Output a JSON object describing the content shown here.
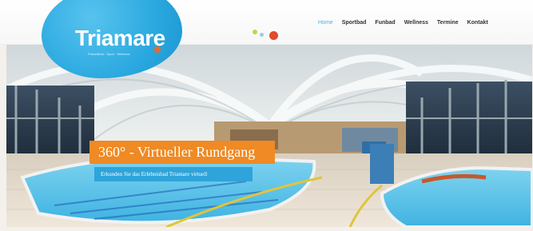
{
  "logo": {
    "name": "Triamare",
    "subline": "Freizeitbad · Sport · Wellness"
  },
  "nav": {
    "items": [
      {
        "label": "Home",
        "active": true
      },
      {
        "label": "Sportbad",
        "active": false
      },
      {
        "label": "Funbad",
        "active": false
      },
      {
        "label": "Wellness",
        "active": false
      },
      {
        "label": "Termine",
        "active": false
      },
      {
        "label": "Kontakt",
        "active": false
      }
    ]
  },
  "hero": {
    "title": "360° - Virtueller Rundgang",
    "subtitle": "Erkunden Sie das Erlebnisbad Triamare virtuell"
  },
  "colors": {
    "logo_blue": "#2aa8df",
    "nav_active": "#46b3e6",
    "banner_orange": "#ef8a24",
    "banner_blue": "#2ea4da",
    "accent_red": "#e04b2c"
  }
}
